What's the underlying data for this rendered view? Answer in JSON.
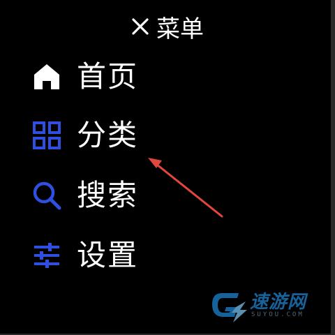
{
  "menu": {
    "header_label": "菜单",
    "items": [
      {
        "label": "首页",
        "icon": "home-icon"
      },
      {
        "label": "分类",
        "icon": "grid-icon"
      },
      {
        "label": "搜索",
        "icon": "search-icon"
      },
      {
        "label": "设置",
        "icon": "sliders-icon"
      }
    ]
  },
  "colors": {
    "background": "#000000",
    "text": "#ffffff",
    "accent": "#2f4fe0",
    "annotation_arrow": "#e0483e",
    "watermark": "#1f8ad8"
  },
  "watermark": {
    "text": "速游网",
    "sub": "SUYOU.COM"
  }
}
